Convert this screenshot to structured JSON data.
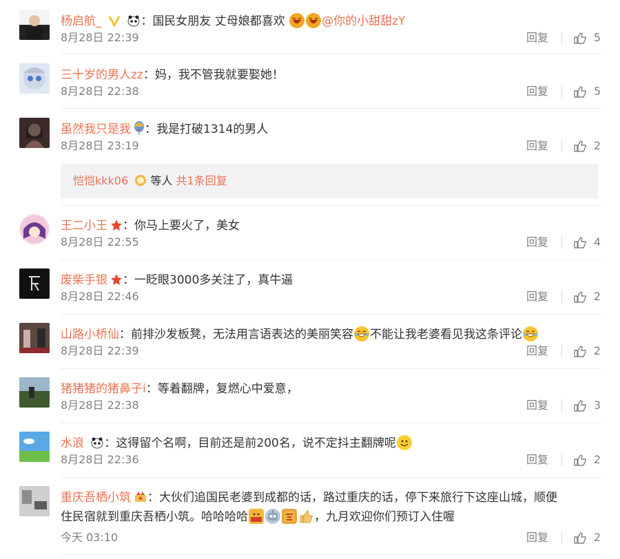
{
  "colors": {
    "username": "#eb7350",
    "meta": "#808080",
    "text": "#333333",
    "divider": "#ececec"
  },
  "comments": [
    {
      "user": "杨启航_",
      "badges": [
        "v-badge-icon",
        "panda-icon"
      ],
      "sep": "：",
      "parts": [
        "国民女朋友 丈母娘都喜欢"
      ],
      "emojis": [
        "laugh-emoji-icon",
        "laugh-emoji-icon"
      ],
      "mention": "@你的小甜甜zY",
      "time": "8月28日 22:39",
      "reply": "回复",
      "likes": "5"
    },
    {
      "user": "三十岁的男人zz",
      "sep": "：",
      "text": "妈，我不管我就要娶她！",
      "time": "8月28日 22:38",
      "reply": "回复",
      "likes": "5"
    },
    {
      "user": "虽然我只是我",
      "sep": "：",
      "text": "我是打破1314的男人",
      "time": "8月28日 23:19",
      "reply": "回复",
      "likes": "2"
    },
    {
      "user": "王二小王",
      "sep": "：",
      "text": "你马上要火了，美女",
      "time": "8月28日 22:55",
      "reply": "回复",
      "likes": "4"
    },
    {
      "user": "废柴手银",
      "sep": "：",
      "text": "一眨眼3000多关注了，真牛逼",
      "time": "8月28日 22:46",
      "reply": "回复",
      "likes": "2"
    },
    {
      "user": "山路小桥仙",
      "sep": "：",
      "text1": "前排沙发板凳，无法用言语表达的美丽笑容",
      "text2": "不能让我老婆看见我这条评论",
      "time": "8月28日 22:39",
      "reply": "回复",
      "likes": "2"
    },
    {
      "user": "猪猪猪的猪鼻子i",
      "sep": "：",
      "text": "等着翻牌，复燃心中爱意，",
      "time": "8月28日 22:38",
      "reply": "回复",
      "likes": "3"
    },
    {
      "user": "水浪",
      "sep": "：",
      "text": "这得留个名啊，目前还是前200名，说不定抖主翻牌呢",
      "time": "8月28日 22:36",
      "reply": "回复",
      "likes": "2"
    },
    {
      "user": "重庆吾栖小筑",
      "sep": "：",
      "line1": "大伙们追国民老婆到成都的话，路过重庆的话，停下来旅行下这座山城，顺便",
      "line2a": "住民宿就到重庆吾栖小筑。哈哈哈哈",
      "line2b": "，九月欢迎你们预订入住喔",
      "time": "今天 03:10",
      "reply": "回复",
      "likes": "2"
    }
  ],
  "sub_replies": {
    "user": "恺恺kkk06",
    "middle": "等人",
    "count": "共1条回复"
  }
}
